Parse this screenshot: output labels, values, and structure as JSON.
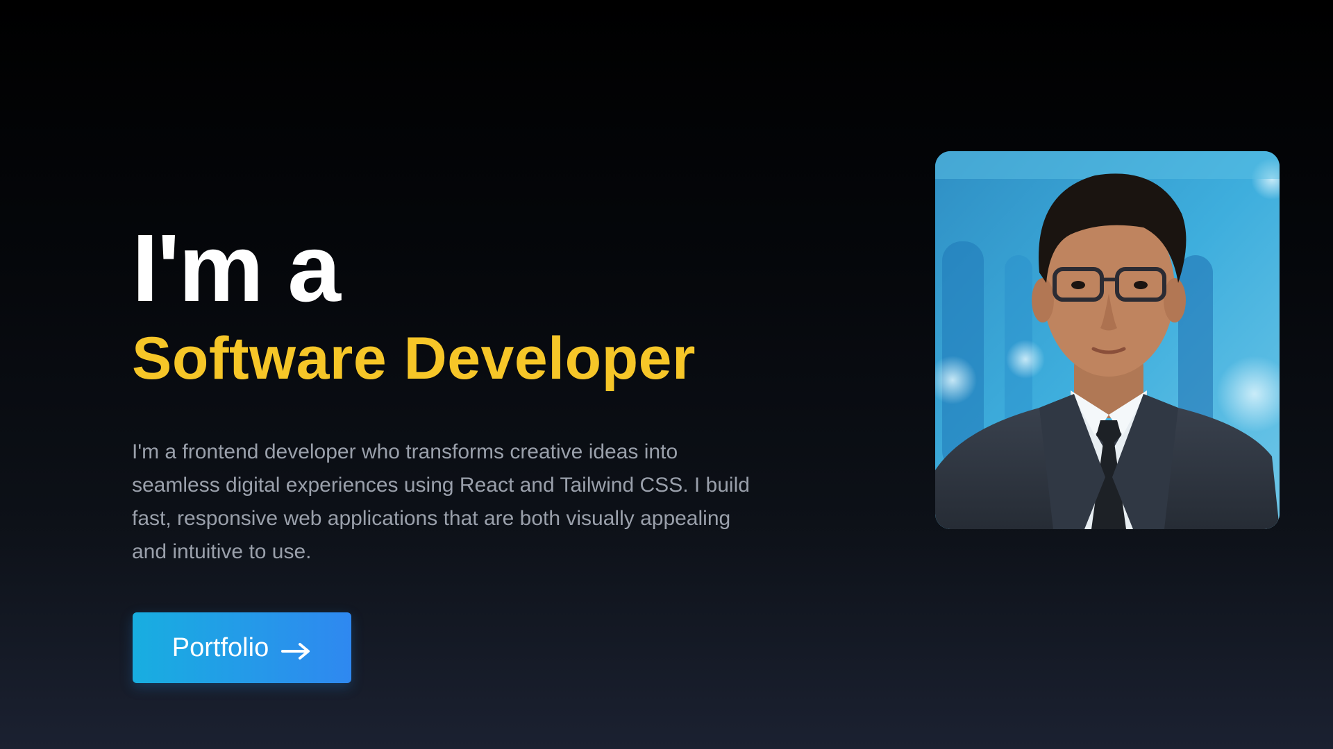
{
  "hero": {
    "heading_line1": "I'm a",
    "heading_line2": "Software Developer",
    "description": "I'm a frontend developer who transforms creative ideas into seamless digital experiences using React and Tailwind CSS. I build fast, responsive web applications that are both visually appealing and intuitive to use.",
    "cta_label": "Portfolio",
    "cta_icon": "arrow-right-icon"
  },
  "colors": {
    "accent_yellow": "#f6c628",
    "button_gradient_start": "#18aee0",
    "button_gradient_end": "#2f88f0",
    "body_text": "#9aa0ab",
    "heading_white": "#ffffff"
  },
  "profile_photo": {
    "icon": "profile-photo"
  }
}
